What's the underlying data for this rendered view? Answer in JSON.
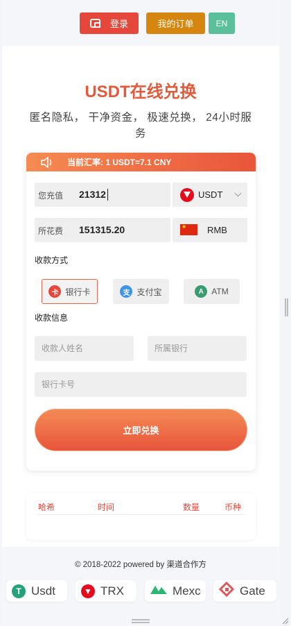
{
  "header": {
    "login_label": "登录",
    "orders_label": "我的订单",
    "lang_label": "EN"
  },
  "hero": {
    "title": "USDT在线兑换",
    "subtitle": "匿名隐私， 干净资金， 极速兑换， 24小时服务"
  },
  "rate": {
    "text": "当前汇率: 1 USDT=7.1 CNY"
  },
  "exchange": {
    "recharge_label": "您充值",
    "recharge_value": "21312",
    "recharge_currency": "USDT",
    "cost_label": "所花费",
    "cost_value": "151315.20",
    "cost_currency": "RMB"
  },
  "payment": {
    "section_label": "收款方式",
    "methods": [
      {
        "label": "银行卡",
        "selected": true
      },
      {
        "label": "支付宝",
        "selected": false
      },
      {
        "label": "ATM",
        "selected": false
      }
    ]
  },
  "receiver": {
    "section_label": "收款信息",
    "name_placeholder": "收款人姓名",
    "bank_placeholder": "所属银行",
    "card_placeholder": "银行卡号"
  },
  "submit_label": "立即兑换",
  "orders_table": {
    "columns": [
      "哈希",
      "时间",
      "数量",
      "币种"
    ]
  },
  "footer": {
    "copyright": "© 2018-2022 powered by 渠道合作方"
  },
  "coins": [
    "Usdt",
    "TRX",
    "Mexc",
    "Gate"
  ],
  "colors": {
    "accent": "#e5483a",
    "orange": "#d4860f",
    "green": "#5cbf9b"
  }
}
